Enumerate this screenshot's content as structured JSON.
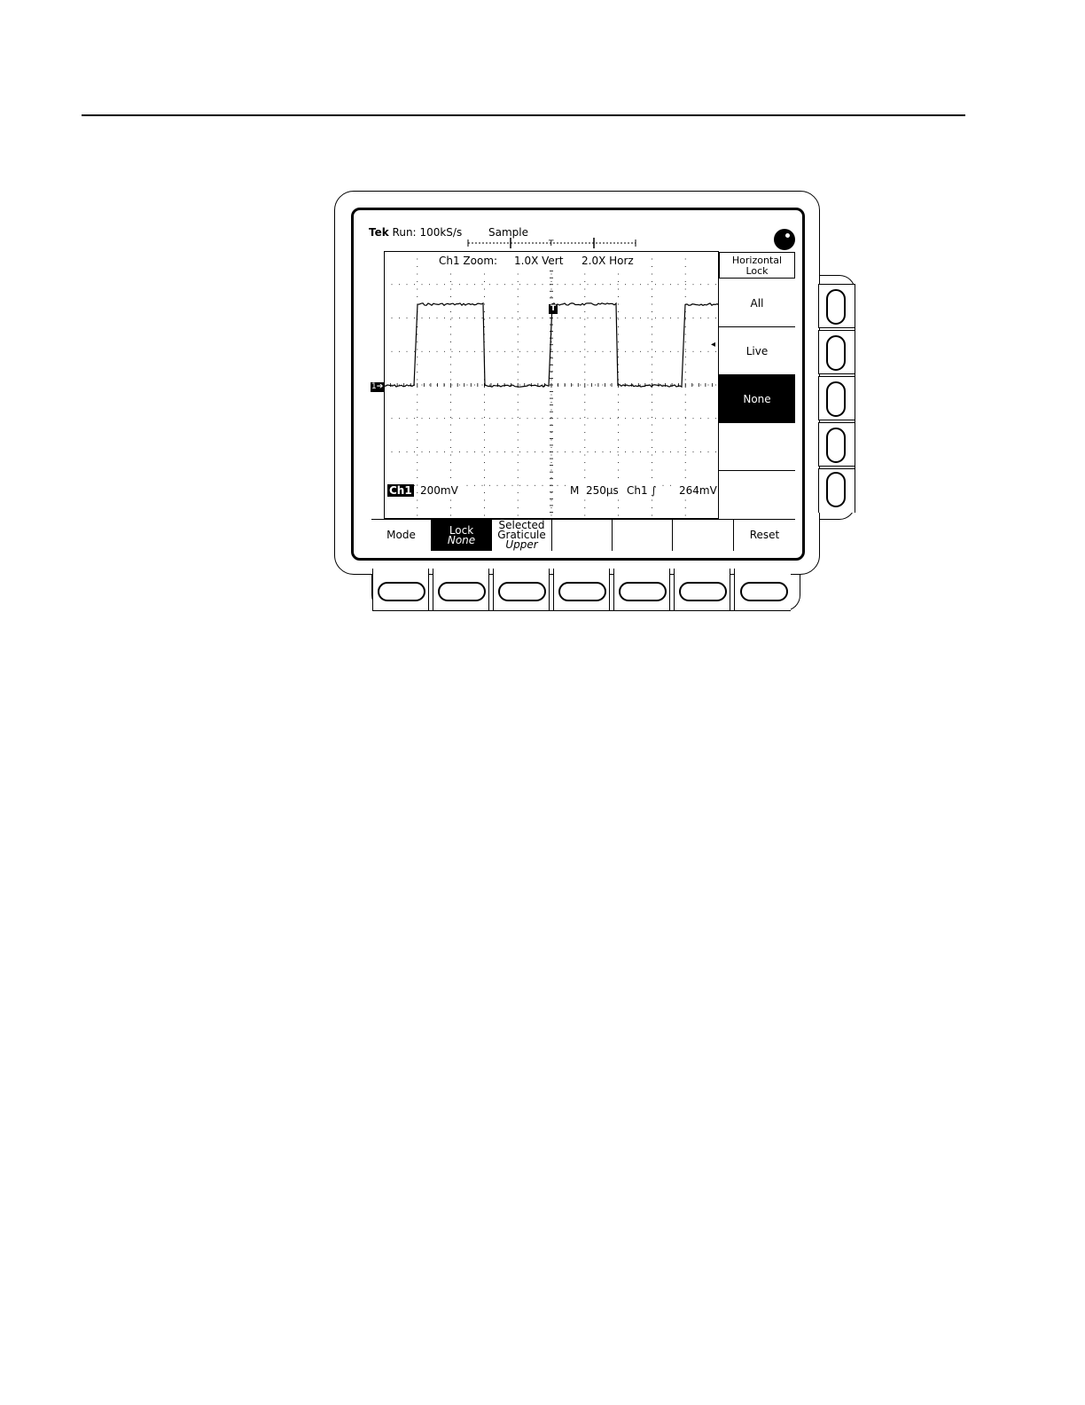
{
  "status_bar": {
    "brand": "Tek",
    "run_label": "Run:",
    "sample_rate": "100kS/s",
    "acq_mode": "Sample"
  },
  "zoom_readout": {
    "channel": "Ch1 Zoom:",
    "vertical": "1.0X Vert",
    "horizontal": "2.0X Horz"
  },
  "readouts": {
    "ch_label": "Ch1",
    "volts_div": "200mV",
    "timebase": "M  250µs",
    "trigger_source": "Ch1 ∫",
    "trigger_level": "264mV"
  },
  "markers": {
    "channel_ground": "1➔",
    "trigger_point": "T"
  },
  "side_menu": {
    "title_line1": "Horizontal",
    "title_line2": "Lock",
    "items": [
      {
        "label": "All",
        "selected": false
      },
      {
        "label": "Live",
        "selected": false
      },
      {
        "label": "None",
        "selected": true
      },
      {
        "label": "",
        "selected": false
      },
      {
        "label": "",
        "selected": false
      }
    ]
  },
  "bottom_menu": {
    "items": [
      {
        "line1": "Mode",
        "line2": "",
        "line3": "",
        "selected": false
      },
      {
        "line1": "Lock",
        "line2": "None",
        "line3": "",
        "selected": true
      },
      {
        "line1": "Selected",
        "line2": "Graticule",
        "line3": "Upper",
        "selected": false
      },
      {
        "line1": "",
        "line2": "",
        "line3": "",
        "selected": false
      },
      {
        "line1": "",
        "line2": "",
        "line3": "",
        "selected": false
      },
      {
        "line1": "",
        "line2": "",
        "line3": "",
        "selected": false
      },
      {
        "line1": "Reset",
        "line2": "",
        "line3": "",
        "selected": false
      }
    ]
  }
}
